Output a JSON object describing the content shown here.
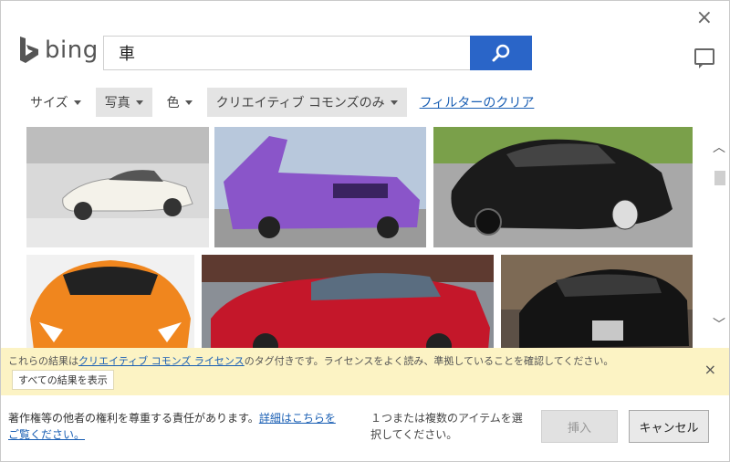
{
  "header": {
    "logo_text": "bing",
    "search_value": "車",
    "close_glyph": "×"
  },
  "filters": {
    "size": "サイズ",
    "type": "写真",
    "color": "色",
    "license": "クリエイティブ コモンズのみ",
    "clear": "フィルターのクリア"
  },
  "results": {
    "images": [
      {
        "subject": "white-classic-car"
      },
      {
        "subject": "purple-custom-van"
      },
      {
        "subject": "black-bugatti"
      },
      {
        "subject": "orange-lamborghini"
      },
      {
        "subject": "red-sedan"
      },
      {
        "subject": "black-rolls-royce"
      }
    ]
  },
  "banner": {
    "text_prefix": "これらの結果は",
    "link_text": "クリエイティブ コモンズ ライセンス",
    "text_suffix": "のタグ付きです。ライセンスをよく読み、準拠していることを確認してください。",
    "show_all": "すべての結果を表示",
    "close_glyph": "×"
  },
  "footer": {
    "rights_text": "著作権等の他者の権利を尊重する責任があります。",
    "rights_link": "詳細はこちらをご覧ください。",
    "select_prompt": "１つまたは複数のアイテムを選択してください。",
    "insert_label": "挿入",
    "cancel_label": "キャンセル"
  },
  "colors": {
    "accent": "#2a65c8",
    "link": "#1a5fb4",
    "banner_bg": "#fcf3c4"
  }
}
